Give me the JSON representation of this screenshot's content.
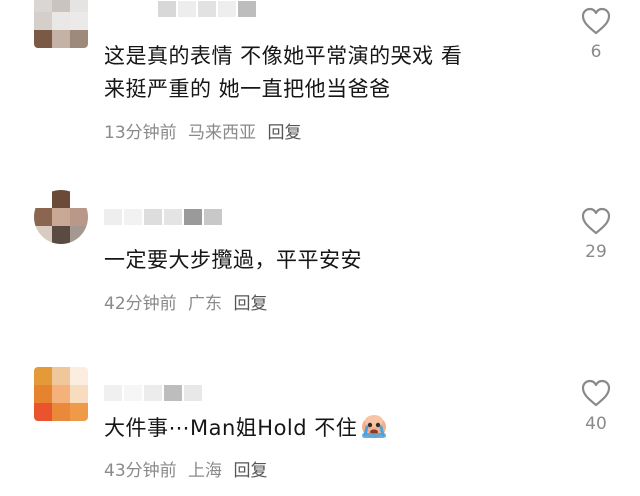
{
  "comments": [
    {
      "text_line1": "这是真的表情  不像她平常演的哭戏  看",
      "text_line2": "来挺严重的  她一直把他当爸爸",
      "time": "13分钟前",
      "location": "马来西亚",
      "reply_label": "回复",
      "likes": "6"
    },
    {
      "text_line1": "一定要大步攬過，平平安安",
      "time": "42分钟前",
      "location": "广东",
      "reply_label": "回复",
      "likes": "29"
    },
    {
      "text_line1": "大件事⋯Man姐Hold 不住",
      "emoji": "crying-face-emoji",
      "time": "43分钟前",
      "location": "上海",
      "reply_label": "回复",
      "likes": "40"
    }
  ],
  "colors": {
    "meta_text": "#8a8a8a",
    "reply_text": "#555555",
    "heart_outline": "#8a8a8a"
  }
}
